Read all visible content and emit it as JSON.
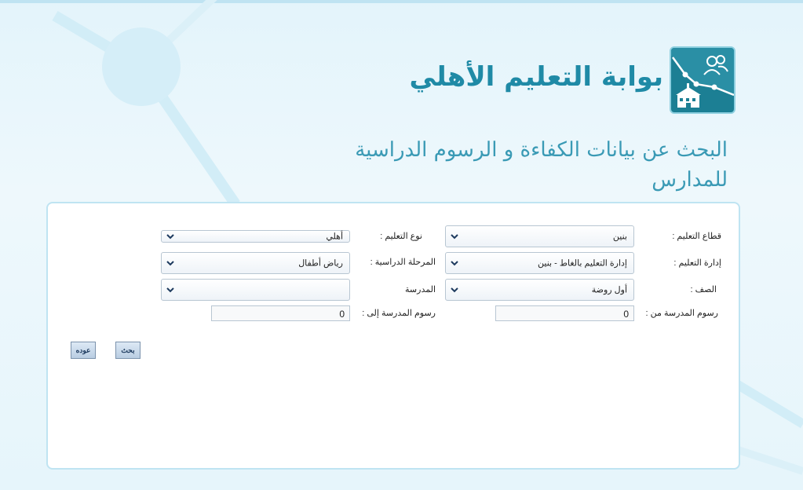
{
  "header": {
    "portal_title": "بوابة التعليم الأهلي",
    "page_heading": "البحث عن بيانات الكفاءة و الرسوم الدراسية للمدارس",
    "logo_icons": [
      "school-building-icon",
      "users-icon"
    ]
  },
  "form": {
    "sector": {
      "label": "قطاع التعليم :",
      "value": "بنين"
    },
    "education_type": {
      "label": "نوع التعليم :",
      "value": "أهلي"
    },
    "administration": {
      "label": "إدارة التعليم :",
      "value": "إدارة التعليم بالغاط - بنين"
    },
    "stage": {
      "label": "المرحلة الدراسية :",
      "value": "رياض أطفال"
    },
    "grade": {
      "label": "الصف :",
      "value": "أول روضة"
    },
    "school": {
      "label": "المدرسة",
      "value": ""
    },
    "fees_from": {
      "label": "رسوم المدرسة من :",
      "value": "0"
    },
    "fees_to": {
      "label": "رسوم المدرسة إلى :",
      "value": "0"
    }
  },
  "buttons": {
    "search": "بحث",
    "back": "عوده"
  },
  "colors": {
    "accent": "#1f8aa6",
    "logo_bg": "#1c7f94",
    "panel_border": "#bfe4f2"
  }
}
